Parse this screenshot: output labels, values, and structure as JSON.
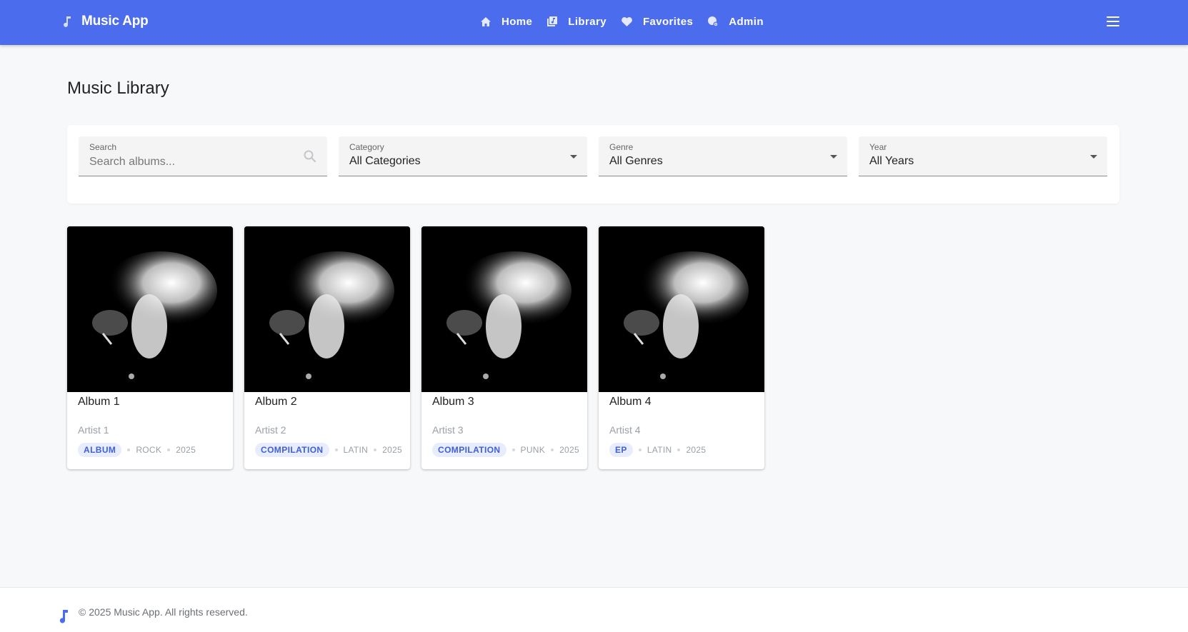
{
  "app": {
    "title": "Music App",
    "accent": "#4a6ced"
  },
  "nav": {
    "items": [
      {
        "label": "Home",
        "icon": "home-icon"
      },
      {
        "label": "Library",
        "icon": "library-icon"
      },
      {
        "label": "Favorites",
        "icon": "heart-icon"
      },
      {
        "label": "Admin",
        "icon": "admin-icon"
      }
    ],
    "menu_icon": "hamburger-menu-icon"
  },
  "page": {
    "title": "Music Library"
  },
  "filters": {
    "search": {
      "label": "Search",
      "placeholder": "Search albums...",
      "value": ""
    },
    "category": {
      "label": "Category",
      "value": "All Categories"
    },
    "genre": {
      "label": "Genre",
      "value": "All Genres"
    },
    "year": {
      "label": "Year",
      "value": "All Years"
    }
  },
  "albums": [
    {
      "title": "Album 1",
      "artist": "Artist 1",
      "type": "ALBUM",
      "genre": "ROCK",
      "year": "2025"
    },
    {
      "title": "Album 2",
      "artist": "Artist 2",
      "type": "COMPILATION",
      "genre": "LATIN",
      "year": "2025"
    },
    {
      "title": "Album 3",
      "artist": "Artist 3",
      "type": "COMPILATION",
      "genre": "PUNK",
      "year": "2025"
    },
    {
      "title": "Album 4",
      "artist": "Artist 4",
      "type": "EP",
      "genre": "LATIN",
      "year": "2025"
    }
  ],
  "footer": {
    "text": "© 2025 Music App. All rights reserved."
  }
}
